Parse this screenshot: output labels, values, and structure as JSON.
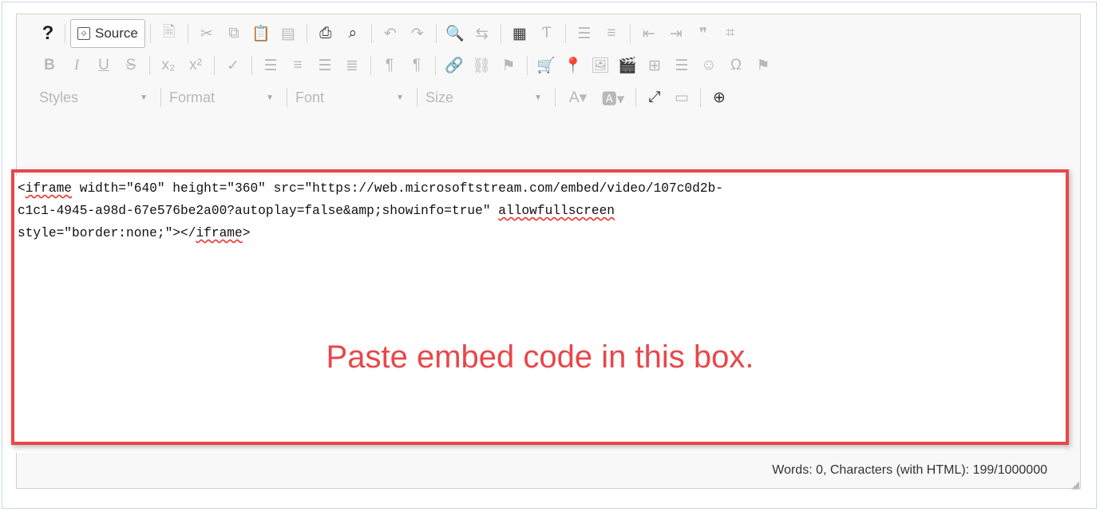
{
  "toolbar": {
    "help_label": "?",
    "source_label": "Source",
    "styles_label": "Styles",
    "format_label": "Format",
    "font_label": "Font",
    "size_label": "Size"
  },
  "content": {
    "lines": [
      "<iframe width=\"640\" height=\"360\" src=\"https://web.microsoftstream.com/embed/video/107c0d2b-",
      "c1c1-4945-a98d-67e576be2a00?autoplay=false&amp;showinfo=true\" allowfullscreen",
      "style=\"border:none;\"></iframe>"
    ]
  },
  "annotation": {
    "text": "Paste embed code in this box.",
    "color": "#e8474a"
  },
  "status": {
    "counter": "Words: 0, Characters (with HTML): 199/1000000"
  }
}
